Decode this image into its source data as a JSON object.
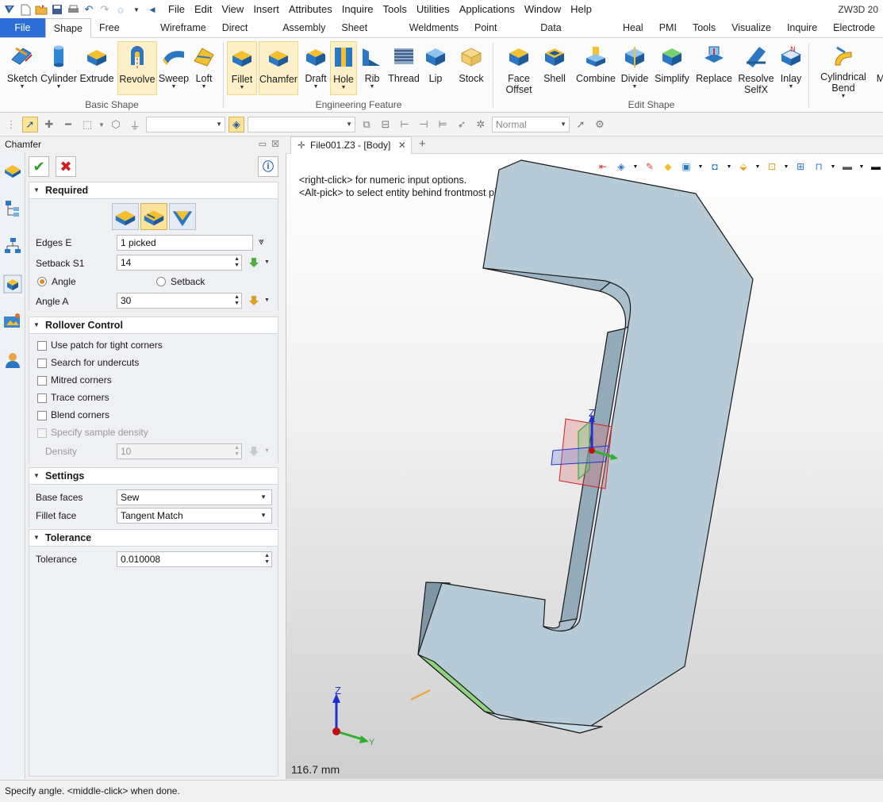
{
  "app": {
    "title": "ZW3D 20"
  },
  "menu": [
    "File",
    "Edit",
    "View",
    "Insert",
    "Attributes",
    "Inquire",
    "Tools",
    "Utilities",
    "Applications",
    "Window",
    "Help"
  ],
  "tabs": [
    "File",
    "Shape",
    "Free Form",
    "Wireframe",
    "Direct Edit",
    "Assembly",
    "Sheet Metal",
    "Weldments",
    "Point Cloud",
    "Data Exchange",
    "Heal",
    "PMI",
    "Tools",
    "Visualize",
    "Inquire",
    "Electrode"
  ],
  "active_tab": "Shape",
  "ribbon": {
    "groups": {
      "basic": "Basic Shape",
      "engineering": "Engineering Feature",
      "edit": "Edit Shape"
    },
    "buttons": {
      "sketch": "Sketch",
      "cylinder": "Cylinder",
      "extrude": "Extrude",
      "revolve": "Revolve",
      "sweep": "Sweep",
      "loft": "Loft",
      "fillet": "Fillet",
      "chamfer": "Chamfer",
      "draft": "Draft",
      "hole": "Hole",
      "rib": "Rib",
      "thread": "Thread",
      "lip": "Lip",
      "stock": "Stock",
      "face_offset": "Face\nOffset",
      "shell": "Shell",
      "combine": "Combine",
      "divide": "Divide",
      "simplify": "Simplify",
      "replace": "Replace",
      "resolve_selfx": "Resolve\nSelfX",
      "inlay": "Inlay",
      "cylindrical_bend": "Cylindrical\nBend",
      "more": "M"
    }
  },
  "toolbar2": {
    "filter_value": "",
    "pick_value": "",
    "display_mode": "Normal"
  },
  "panel": {
    "title": "Chamfer",
    "sections": {
      "required": "Required",
      "rollover": "Rollover Control",
      "settings": "Settings",
      "tolerance": "Tolerance"
    },
    "required": {
      "edges_label": "Edges E",
      "edges_value": "1 picked",
      "setback_label": "Setback S1",
      "setback_value": "14",
      "mode_angle": "Angle",
      "mode_setback": "Setback",
      "mode_selected": "Angle",
      "angle_label": "Angle A",
      "angle_value": "30"
    },
    "rollover": {
      "options": [
        "Use patch for tight corners",
        "Search for undercuts",
        "Mitred corners",
        "Trace corners",
        "Blend corners",
        "Specify sample density"
      ],
      "density_label": "Density",
      "density_value": "10"
    },
    "settings": {
      "base_faces_label": "Base faces",
      "base_faces_value": "Sew",
      "fillet_face_label": "Fillet face",
      "fillet_face_value": "Tangent Match"
    },
    "tolerance": {
      "label": "Tolerance",
      "value": "0.010008"
    }
  },
  "document": {
    "tab_label": "File001.Z3 - [Body]"
  },
  "viewport": {
    "hint1": "<right-click> for numeric input options.",
    "hint2": "<Alt-pick> to select entity behind frontmost pick.",
    "scale": "116.7 mm",
    "triad_z": "Z",
    "triad_y": "Y",
    "manip_z": "Z"
  },
  "status": "Specify angle.  <middle-click> when done.",
  "colors": {
    "accent": "#2b6fd6",
    "body": "#b7cbd7",
    "body_dark": "#8ea4b2",
    "chamfer_face": "#8fd47c",
    "highlight": "#fbe39a"
  }
}
